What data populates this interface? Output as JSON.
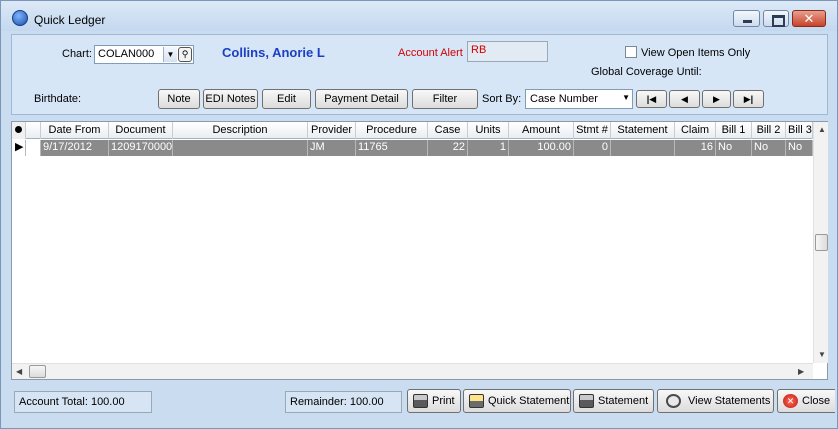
{
  "window": {
    "title": "Quick Ledger"
  },
  "header": {
    "chart_label": "Chart:",
    "chart_value": "COLAN000",
    "patient_name": "Collins, Anorie L",
    "account_alert_label": "Account Alert",
    "account_alert_value": "RB",
    "view_open_items_label": "View Open Items Only",
    "global_coverage_label": "Global Coverage Until:",
    "birthdate_label": "Birthdate:",
    "buttons": {
      "note": "Note",
      "edi_notes": "EDI Notes",
      "edit": "Edit",
      "payment_detail": "Payment Detail",
      "filter": "Filter"
    },
    "sort_by_label": "Sort By:",
    "sort_by_value": "Case Number",
    "nav": {
      "first": "|◀",
      "prev": "◀",
      "next": "▶",
      "last": "▶|"
    }
  },
  "grid": {
    "columns": [
      "Date From",
      "Document",
      "Description",
      "Provider",
      "Procedure",
      "Case",
      "Units",
      "Amount",
      "Stmt #",
      "Statement",
      "Claim",
      "Bill 1",
      "Bill 2",
      "Bill 3"
    ],
    "rows": [
      {
        "date_from": "9/17/2012",
        "document": "1209170000",
        "description": "",
        "provider": "JM",
        "procedure": "11765",
        "case": "22",
        "units": "1",
        "amount": "100.00",
        "stmt": "0",
        "statement": "",
        "claim": "16",
        "bill1": "No",
        "bill2": "No",
        "bill3": "No"
      }
    ]
  },
  "footer": {
    "account_total": "Account Total: 100.00",
    "remainder": "Remainder: 100.00",
    "print": "Print",
    "quick_statement": "Quick Statement",
    "statement": "Statement",
    "view_statements": "View Statements",
    "close": "Close"
  },
  "icons": {
    "print": "printer-icon",
    "quick_statement": "report-icon",
    "statement": "printer-icon",
    "view_statements": "view-icon",
    "close": "close-icon"
  }
}
